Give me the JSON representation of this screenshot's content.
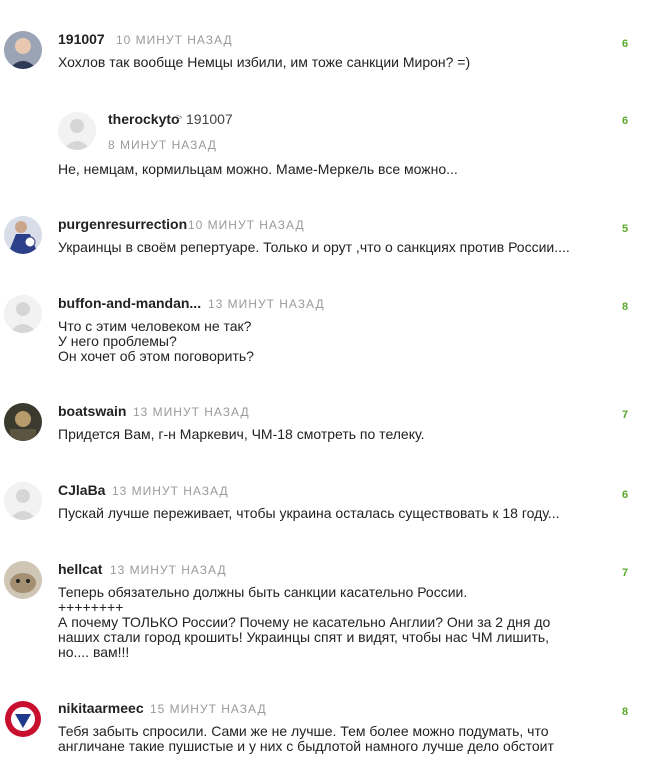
{
  "comments": [
    {
      "author": "191007",
      "time": "10 МИНУТ НАЗАД",
      "text": "Хохлов так вообще Немцы избили, им тоже санкции Мирон? =)",
      "score": "6"
    },
    {
      "author": "therockyto",
      "reply_arrow": ">",
      "reply_to": "191007",
      "time": "8 МИНУТ НАЗАД",
      "text": "Не, немцам, кормильцам можно. Маме-Меркель все можно...",
      "score": "6"
    },
    {
      "author": "purgenresurrection",
      "time": "10 МИНУТ НАЗАД",
      "text": "Украинцы в своём репертуаре. Только и орут ,что о санкциях против России....",
      "score": "5"
    },
    {
      "author": "buffon-and-mandan...",
      "time": "13 МИНУТ НАЗАД",
      "text": "Что с этим человеком не так?\nУ него проблемы?\nОн хочет об этом поговорить?",
      "score": "8"
    },
    {
      "author": "boatswain",
      "time": "13 МИНУТ НАЗАД",
      "text": "Придется Вам, г-н Маркевич, ЧМ-18 смотреть по телеку.",
      "score": "7"
    },
    {
      "author": "CJlaBa",
      "time": "13 МИНУТ НАЗАД",
      "text": "Пускай лучше переживает, чтобы украина осталась существовать к 18 году...",
      "score": "6"
    },
    {
      "author": "hellcat",
      "time": "13 МИНУТ НАЗАД",
      "text": "Теперь обязательно должны быть санкции касательно России.\n++++++++\nА почему ТОЛЬКО России? Почему не касательно Англии? Они за 2 дня до\nнаших стали город крошить! Украинцы спят и видят, чтобы нас ЧМ лишить,\nно.... вам!!!",
      "score": "7"
    },
    {
      "author": "nikitaarmeec",
      "time": "15 МИНУТ НАЗАД",
      "text": "Тебя забыть спросили. Сами же не лучше. Тем более можно подумать, что\nангличане такие пушистые и у них с быдлотой намного лучше дело обстоит",
      "score": "8"
    }
  ],
  "colors": {
    "score": "#5aa82a",
    "timestamp": "#9a9a9a",
    "text": "#222222"
  }
}
